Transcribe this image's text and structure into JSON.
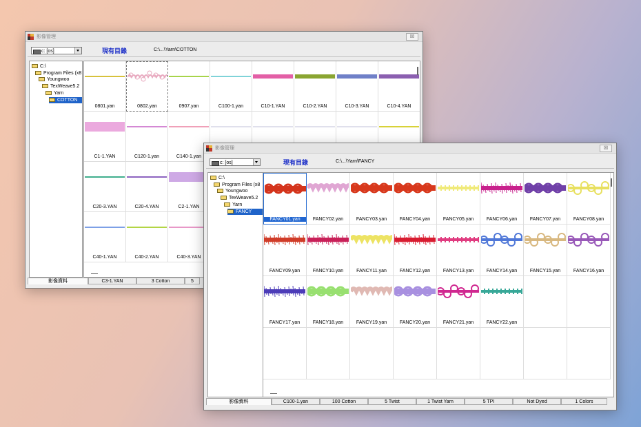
{
  "window1": {
    "title": "影像管理",
    "drive": "c: [os]",
    "current_label": "現有目錄",
    "current_path": "C:\\...\\Yarn\\COTTON",
    "close": "☒",
    "tree": [
      {
        "label": "C:\\",
        "indent": 0
      },
      {
        "label": "Program Files (x8",
        "indent": 1
      },
      {
        "label": "Youngwoo",
        "indent": 2
      },
      {
        "label": "TexWeave5.2",
        "indent": 3
      },
      {
        "label": "Yarn",
        "indent": 4
      },
      {
        "label": "COTTON",
        "indent": 5,
        "selected": true
      }
    ],
    "rows": [
      [
        {
          "name": "0801.yan",
          "color": "#d7c23c"
        },
        {
          "name": "0802.yan",
          "color": "#e8a9bf",
          "style": "fancy",
          "selected": true
        },
        {
          "name": "0907.yan",
          "color": "#a7d44b"
        },
        {
          "name": "C100-1.yan",
          "color": "#7fd3d8"
        },
        {
          "name": "C10-1.YAN",
          "color": "#e35fa6",
          "thick": true
        },
        {
          "name": "C10-2.YAN",
          "color": "#8aa531",
          "thick": true
        },
        {
          "name": "C10-3.YAN",
          "color": "#6f80c8",
          "thick": true
        },
        {
          "name": "C10-4.YAN",
          "color": "#8b5fb0",
          "thick": true
        }
      ],
      [
        {
          "name": "C1-1.YAN",
          "color": "#e79ad8",
          "block": true
        },
        {
          "name": "C120-1.yan",
          "color": "#d488d4"
        },
        {
          "name": "C140-1.yan",
          "color": "#f0a0b8"
        },
        {
          "name": "",
          "color": "#e0e0ec"
        },
        {
          "name": "",
          "color": "#e0e0ec"
        },
        {
          "name": "",
          "color": "#e0e0ec"
        },
        {
          "name": "",
          "color": "#e0e0ec"
        },
        {
          "name": "",
          "color": "#d8d238"
        }
      ],
      [
        {
          "name": "C20-3.YAN",
          "color": "#3fae8d"
        },
        {
          "name": "C20-4.YAN",
          "color": "#8d63c0"
        },
        {
          "name": "C2-1.YAN",
          "color": "#c59ae0",
          "block": true
        },
        {
          "name": "",
          "color": "#d7b7ef"
        },
        {
          "name": "",
          "color": ""
        },
        {
          "name": "",
          "color": ""
        },
        {
          "name": "",
          "color": ""
        },
        {
          "name": "",
          "color": ""
        }
      ],
      [
        {
          "name": "C40-1.YAN",
          "color": "#7da0e6"
        },
        {
          "name": "C40-2.YAN",
          "color": "#b3d545"
        },
        {
          "name": "C40-3.YAN",
          "color": "#e898c8"
        },
        {
          "name": "",
          "color": ""
        },
        {
          "name": "",
          "color": ""
        },
        {
          "name": "",
          "color": ""
        },
        {
          "name": "",
          "color": ""
        },
        {
          "name": "",
          "color": ""
        }
      ]
    ],
    "status": [
      "影像資料",
      "C3-1.YAN",
      "3 Cotton",
      "5"
    ]
  },
  "window2": {
    "title": "影像管理",
    "drive": "c: [os]",
    "current_label": "現有目錄",
    "current_path": "C:\\...\\Yarn\\FANCY",
    "close": "☒",
    "tree": [
      {
        "label": "C:\\",
        "indent": 0
      },
      {
        "label": "Program Files (x8",
        "indent": 1
      },
      {
        "label": "Youngwoo",
        "indent": 2
      },
      {
        "label": "TexWeave5.2",
        "indent": 3
      },
      {
        "label": "Yarn",
        "indent": 4
      },
      {
        "label": "FANCY",
        "indent": 5,
        "selected": true
      }
    ],
    "rows": [
      [
        {
          "name": "FANCY01.yan",
          "color": "#d4341c",
          "style": "knot",
          "selected": true
        },
        {
          "name": "FANCY02.yan",
          "color": "#d890c8",
          "style": "wave"
        },
        {
          "name": "FANCY03.yan",
          "color": "#d8381c",
          "style": "knot"
        },
        {
          "name": "FANCY04.yan",
          "color": "#d8381c",
          "style": "knot"
        },
        {
          "name": "FANCY05.yan",
          "color": "#f0ea7a",
          "style": "thin"
        },
        {
          "name": "FANCY06.yan",
          "color": "#c8208c",
          "style": "hair"
        },
        {
          "name": "FANCY07.yan",
          "color": "#7040a8",
          "style": "knot"
        },
        {
          "name": "FANCY08.yan",
          "color": "#e8e060",
          "style": "loop"
        }
      ],
      [
        {
          "name": "FANCY09.yan",
          "color": "#d03c28",
          "style": "hair"
        },
        {
          "name": "FANCY10.yan",
          "color": "#c82058",
          "style": "hair"
        },
        {
          "name": "FANCY11.yan",
          "color": "#e8dc3c",
          "style": "wave"
        },
        {
          "name": "FANCY12.yan",
          "color": "#d81c30",
          "style": "hair"
        },
        {
          "name": "FANCY13.yan",
          "color": "#e03c80",
          "style": "thin"
        },
        {
          "name": "FANCY14.yan",
          "color": "#5078d8",
          "style": "loop"
        },
        {
          "name": "FANCY15.yan",
          "color": "#d8b880",
          "style": "loop"
        },
        {
          "name": "FANCY16.yan",
          "color": "#9858b8",
          "style": "loop"
        }
      ],
      [
        {
          "name": "FANCY17.yan",
          "color": "#4c3cb8",
          "style": "hair"
        },
        {
          "name": "FANCY18.yan",
          "color": "#98e070",
          "style": "knot"
        },
        {
          "name": "FANCY19.yan",
          "color": "#d8a8a0",
          "style": "wave"
        },
        {
          "name": "FANCY20.yan",
          "color": "#a890e0",
          "style": "knot"
        },
        {
          "name": "FANCY21.yan",
          "color": "#d02890",
          "style": "loop"
        },
        {
          "name": "FANCY22.yan",
          "color": "#38a898",
          "style": "thin"
        },
        {
          "name": "",
          "color": ""
        },
        {
          "name": "",
          "color": ""
        }
      ],
      [
        {
          "name": "",
          "color": ""
        },
        {
          "name": "",
          "color": ""
        },
        {
          "name": "",
          "color": ""
        },
        {
          "name": "",
          "color": ""
        },
        {
          "name": "",
          "color": ""
        },
        {
          "name": "",
          "color": ""
        },
        {
          "name": "",
          "color": ""
        },
        {
          "name": "",
          "color": ""
        }
      ]
    ],
    "status": [
      "影像資料",
      "C100-1.yan",
      "100 Cotton",
      "5 Twist",
      "1 Twist Yarn",
      "5 TPI",
      "Not Dyed",
      "1 Colors"
    ]
  }
}
